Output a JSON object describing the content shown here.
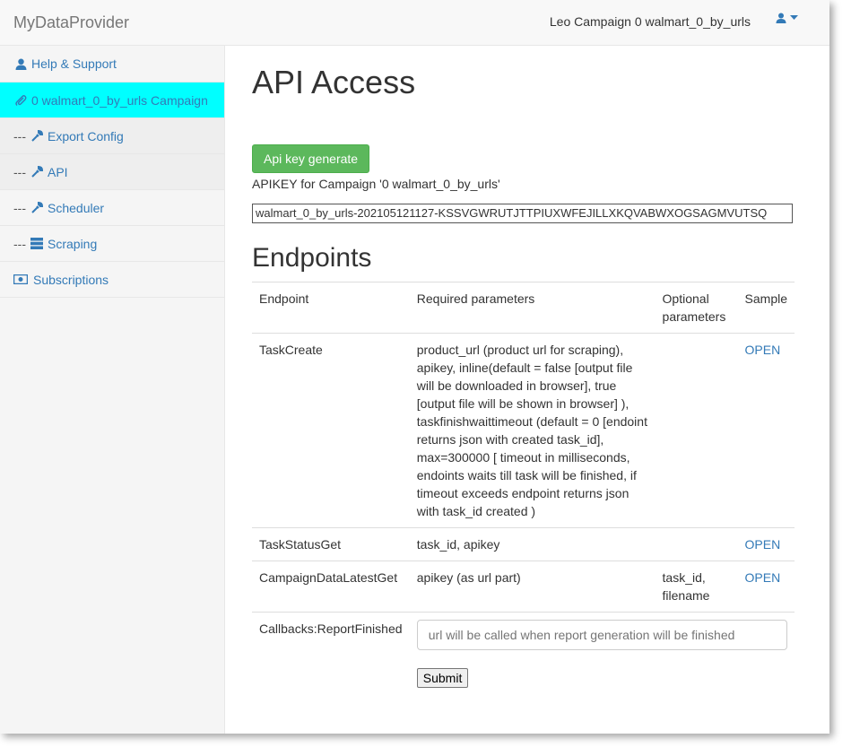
{
  "navbar": {
    "brand": "MyDataProvider",
    "campaign_text": "Leo Campaign 0 walmart_0_by_urls"
  },
  "sidebar": {
    "items": [
      {
        "prefix": "",
        "icon": "user-icon",
        "label": "Help & Support"
      },
      {
        "prefix": "",
        "icon": "paperclip-icon",
        "label": "0 walmart_0_by_urls Campaign"
      },
      {
        "prefix": "---",
        "icon": "wrench-icon",
        "label": "Export Config"
      },
      {
        "prefix": "---",
        "icon": "wrench-icon",
        "label": "API"
      },
      {
        "prefix": "---",
        "icon": "wrench-icon",
        "label": "Scheduler"
      },
      {
        "prefix": "---",
        "icon": "server-icon",
        "label": "Scraping"
      },
      {
        "prefix": "",
        "icon": "money-icon",
        "label": "Subscriptions"
      }
    ]
  },
  "main": {
    "title": "API Access",
    "generate_button": "Api key generate",
    "apikey_label": "APIKEY for Campaign '0 walmart_0_by_urls'",
    "apikey_value": "walmart_0_by_urls-202105121127-KSSVGWRUTJTTPIUXWFEJILLXKQVABWXOGSAGMVUTSQ",
    "endpoints_title": "Endpoints",
    "table": {
      "headers": [
        "Endpoint",
        "Required parameters",
        "Optional parameters",
        "Sample"
      ],
      "rows": [
        {
          "endpoint": "TaskCreate",
          "required": "product_url (product url for scraping), apikey, inline(default = false [output file will be downloaded in browser], true [output file will be shown in browser] ), taskfinishwaittimeout (default = 0 [endoint returns json with created task_id], max=300000 [ timeout in milliseconds, endoints waits till task will be finished, if timeout exceeds endpoint returns json with task_id created )",
          "optional": "",
          "sample": "OPEN"
        },
        {
          "endpoint": "TaskStatusGet",
          "required": "task_id, apikey",
          "optional": "",
          "sample": "OPEN"
        },
        {
          "endpoint": "CampaignDataLatestGet",
          "required": "apikey (as url part)",
          "optional": "task_id, filename",
          "sample": "OPEN"
        }
      ],
      "callbacks": {
        "endpoint": "Callbacks:ReportFinished",
        "placeholder": "url will be called when report generation will be finished",
        "submit": "Submit"
      }
    }
  }
}
